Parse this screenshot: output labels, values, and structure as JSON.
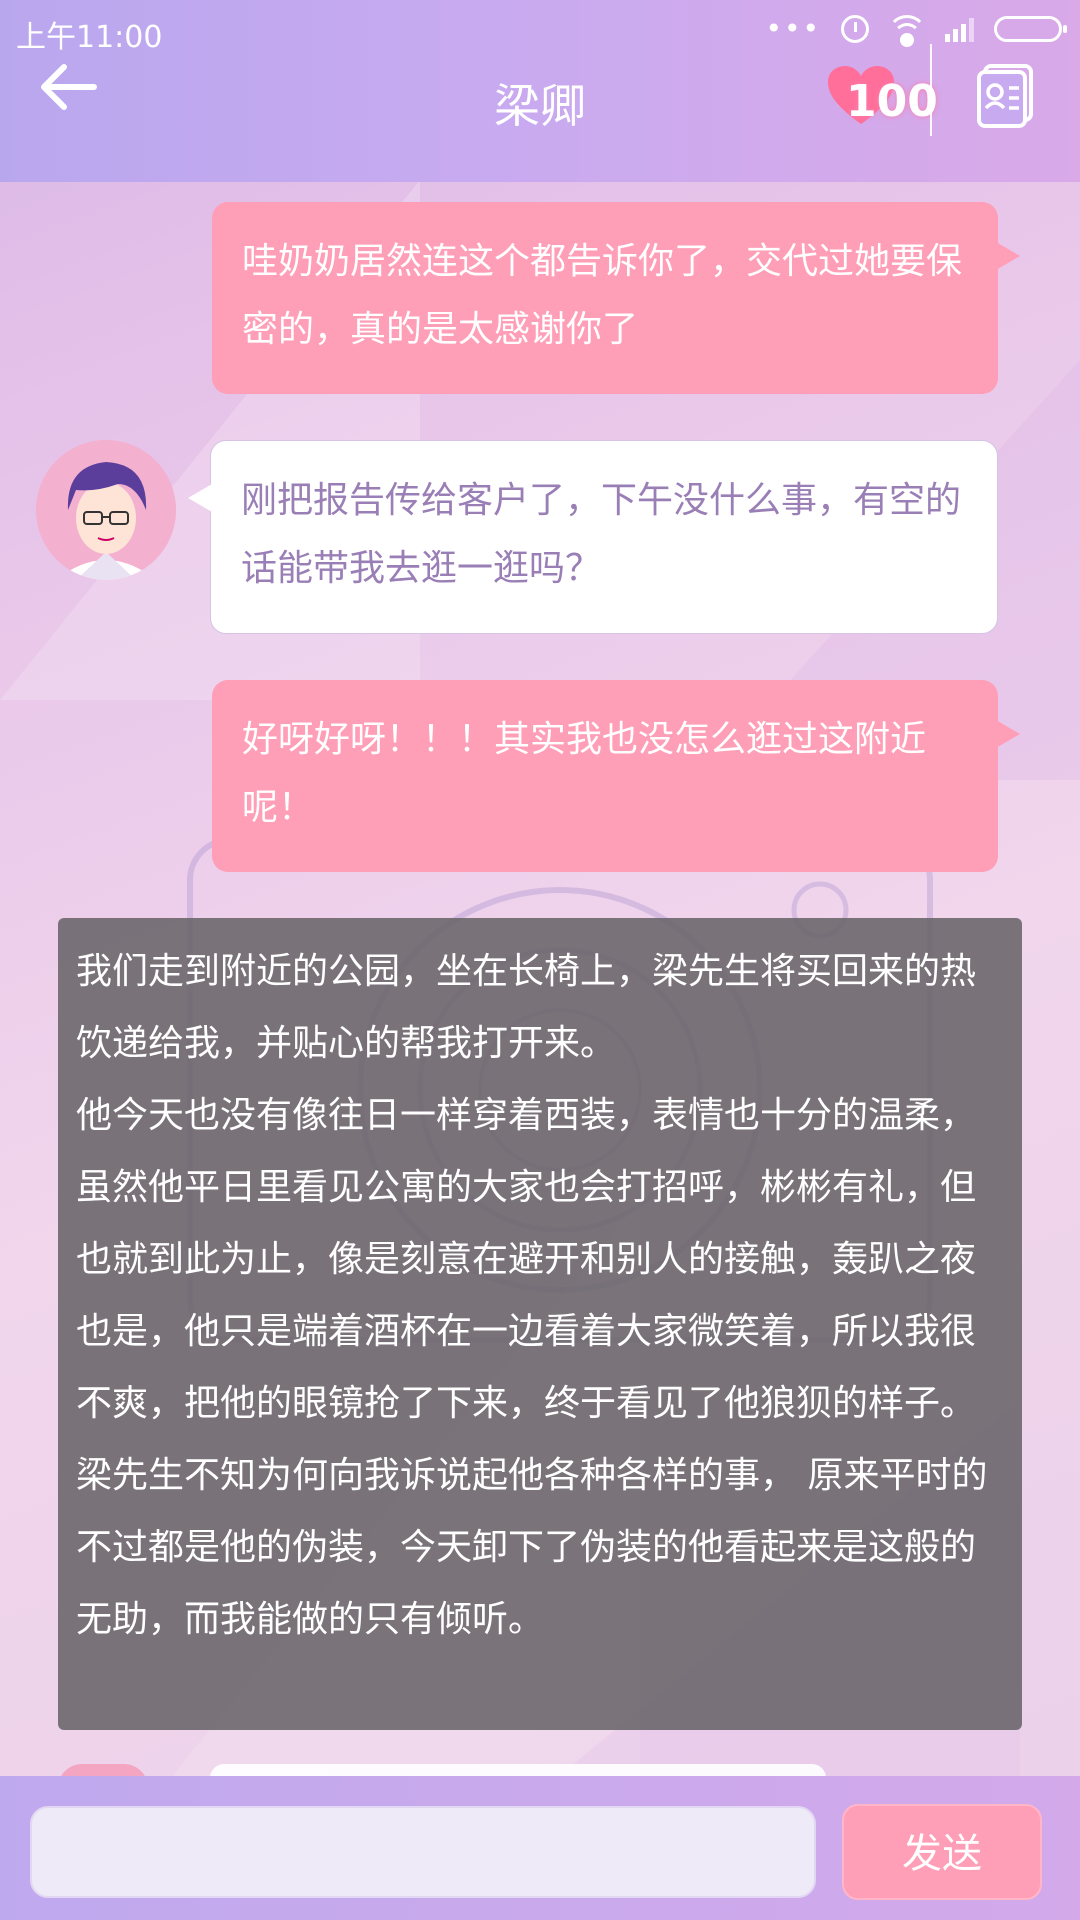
{
  "status_bar": {
    "time": "上午11:00",
    "dots": "•••"
  },
  "header": {
    "title": "梁卿",
    "favor_count": "100"
  },
  "messages": [
    {
      "side": "right",
      "text": "哇奶奶居然连这个都告诉你了，交代过她要保密的，真的是太感谢你了"
    },
    {
      "side": "left",
      "text": "刚把报告传给客户了，下午没什么事，有空的话能带我去逛一逛吗？"
    },
    {
      "side": "right",
      "text": "好呀好呀！！！其实我也没怎么逛过这附近呢！"
    }
  ],
  "narration": {
    "paragraphs": [
      "我们走到附近的公园，坐在长椅上，梁先生将买回来的热饮递给我，并贴心的帮我打开来。",
      "他今天也没有像往日一样穿着西装，表情也十分的温柔，虽然他平日里看见公寓的大家也会打招呼，彬彬有礼，但也就到此为止，像是刻意在避开和别人的接触，轰趴之夜也是，他只是端着酒杯在一边看着大家微笑着，所以我很不爽，把他的眼镜抢了下来，终于看见了他狼狈的样子。",
      "梁先生不知为何向我诉说起他各种各样的事， 原来平时的不过都是他的伪装，今天卸下了伪装的他看起来是这般的无助，而我能做的只有倾听。"
    ]
  },
  "input": {
    "value": "",
    "send_label": "发送"
  },
  "colors": {
    "accent_pink": "#ff9eb7",
    "header_purple": "#c8aaf0",
    "left_text": "#9a7fb6"
  },
  "icons": {
    "back": "arrow-left-icon",
    "heart": "heart-icon",
    "profile": "profile-card-icon"
  }
}
